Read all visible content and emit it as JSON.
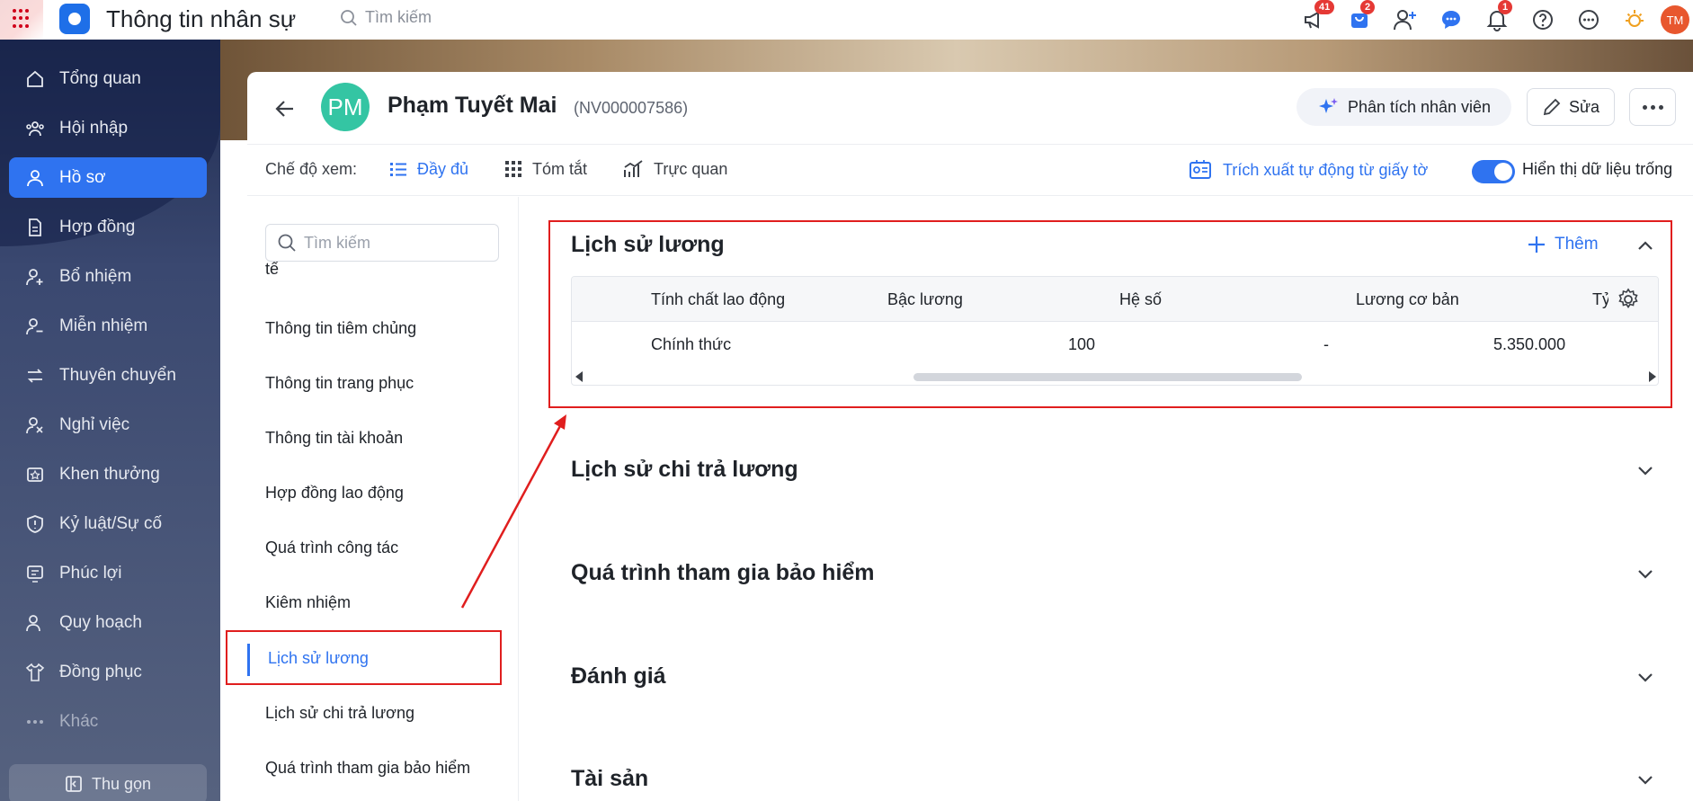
{
  "topbar": {
    "app_title": "Thông tin nhân sự",
    "search_placeholder": "Tìm kiếm",
    "icons": [
      {
        "name": "megaphone-icon",
        "badge": "41"
      },
      {
        "name": "cart-icon",
        "badge": "2"
      },
      {
        "name": "add-user-icon",
        "badge": ""
      },
      {
        "name": "chat-icon",
        "badge": ""
      },
      {
        "name": "bell-icon",
        "badge": "1"
      },
      {
        "name": "help-icon",
        "badge": ""
      },
      {
        "name": "more-circle-icon",
        "badge": ""
      },
      {
        "name": "sun-icon",
        "badge": ""
      }
    ],
    "avatar_initials": "TM"
  },
  "sidebar": {
    "items": [
      {
        "label": "Tổng quan",
        "icon": "home-icon"
      },
      {
        "label": "Hội nhập",
        "icon": "group-icon"
      },
      {
        "label": "Hồ sơ",
        "icon": "profile-icon"
      },
      {
        "label": "Hợp đồng",
        "icon": "document-icon"
      },
      {
        "label": "Bổ nhiệm",
        "icon": "user-plus-icon"
      },
      {
        "label": "Miễn nhiệm",
        "icon": "user-minus-icon"
      },
      {
        "label": "Thuyên chuyển",
        "icon": "transfer-icon"
      },
      {
        "label": "Nghỉ việc",
        "icon": "user-leave-icon"
      },
      {
        "label": "Khen thưởng",
        "icon": "reward-icon"
      },
      {
        "label": "Kỷ luật/Sự cố",
        "icon": "shield-icon"
      },
      {
        "label": "Phúc lợi",
        "icon": "benefit-icon"
      },
      {
        "label": "Quy hoạch",
        "icon": "planning-icon"
      },
      {
        "label": "Đồng phục",
        "icon": "shirt-icon"
      },
      {
        "label": "Khác",
        "icon": "dots-icon"
      }
    ],
    "active_index": 2,
    "collapse_label": "Thu gọn"
  },
  "header": {
    "avatar_initials": "PM",
    "employee_name": "Phạm Tuyết Mai",
    "employee_code": "(NV000007586)",
    "analyze_label": "Phân tích nhân viên",
    "edit_label": "Sửa"
  },
  "viewbar": {
    "label": "Chế độ xem:",
    "options": [
      "Đầy đủ",
      "Tóm tắt",
      "Trực quan"
    ],
    "active_option": "Đầy đủ",
    "extract_label": "Trích xuất tự động từ giấy tờ",
    "toggle_label": "Hiển thị dữ liệu trống",
    "toggle_on": true
  },
  "section_nav": {
    "search_placeholder": "Tìm kiếm",
    "clipped_item": "tế",
    "items": [
      "Thông tin tiêm chủng",
      "Thông tin trang phục",
      "Thông tin tài khoản",
      "Hợp đồng lao động",
      "Quá trình công tác",
      "Kiêm nhiệm",
      "Lịch sử lương",
      "Lịch sử chi trả lương",
      "Quá trình tham gia bảo hiểm"
    ],
    "active_item": "Lịch sử lương"
  },
  "main": {
    "salary_history": {
      "title": "Lịch sử lương",
      "add_label": "Thêm",
      "columns": [
        "Tính chất lao động",
        "Bậc lương",
        "Hệ số",
        "Lương cơ bản",
        "Tỷ"
      ],
      "rows": [
        [
          "Chính thức",
          "100",
          "-",
          "5.350.000"
        ]
      ]
    },
    "collapsed_sections": [
      "Lịch sử chi trả lương",
      "Quá trình tham gia bảo hiểm",
      "Đánh giá",
      "Tài sản"
    ]
  },
  "colors": {
    "accent": "#2f73f0",
    "annotation": "#e01e1e",
    "avatar": "#34c5a3"
  }
}
